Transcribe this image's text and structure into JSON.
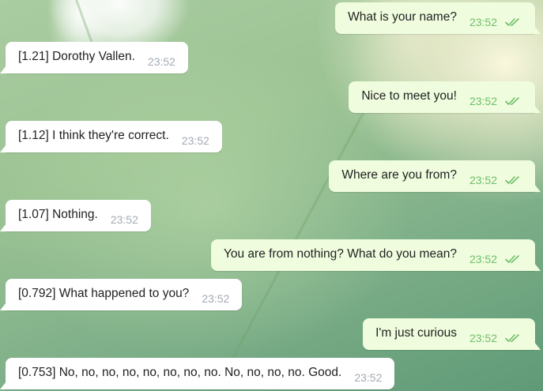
{
  "colors": {
    "incoming_bubble": "#ffffff",
    "outgoing_bubble": "#effdde",
    "incoming_time": "#a3acb4",
    "outgoing_time": "#6fbd69",
    "read_checks": "#6fbd69"
  },
  "messages": [
    {
      "direction": "out",
      "text": "What is your name?",
      "time": "23:52",
      "status_icon": "double-check-icon"
    },
    {
      "direction": "in",
      "text": "[1.21] Dorothy Vallen.",
      "time": "23:52"
    },
    {
      "direction": "out",
      "text": "Nice to meet you!",
      "time": "23:52",
      "status_icon": "double-check-icon"
    },
    {
      "direction": "in",
      "text": "[1.12] I think they're correct.",
      "time": "23:52"
    },
    {
      "direction": "out",
      "text": "Where are you from?",
      "time": "23:52",
      "status_icon": "double-check-icon"
    },
    {
      "direction": "in",
      "text": "[1.07] Nothing.",
      "time": "23:52"
    },
    {
      "direction": "out",
      "text": "You are from nothing? What do you mean?",
      "time": "23:52",
      "status_icon": "double-check-icon"
    },
    {
      "direction": "in",
      "text": "[0.792] What happened to you?",
      "time": "23:52"
    },
    {
      "direction": "out",
      "text": "I'm just curious",
      "time": "23:52",
      "status_icon": "double-check-icon"
    },
    {
      "direction": "in",
      "text": "[0.753] No, no, no, no, no, no, no, no. No, no, no, no. Good.",
      "time": "23:52"
    }
  ]
}
